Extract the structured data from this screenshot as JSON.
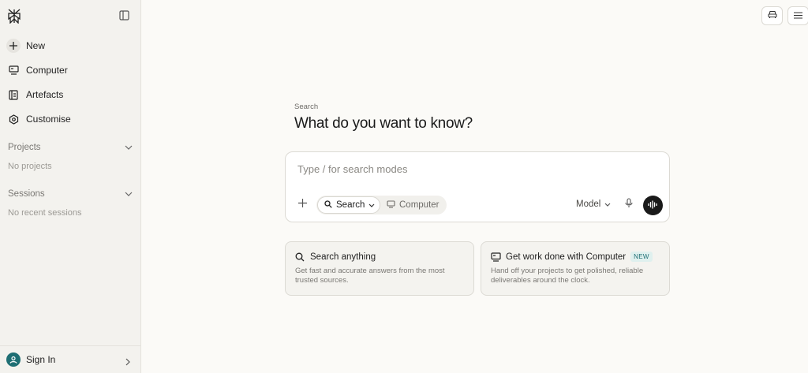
{
  "sidebar": {
    "nav": [
      {
        "label": "New",
        "icon": "plus-icon"
      },
      {
        "label": "Computer",
        "icon": "computer-icon"
      },
      {
        "label": "Artefacts",
        "icon": "artefacts-icon"
      },
      {
        "label": "Customise",
        "icon": "customise-icon"
      }
    ],
    "projects": {
      "title": "Projects",
      "empty": "No projects"
    },
    "sessions": {
      "title": "Sessions",
      "empty": "No recent sessions"
    },
    "signin_label": "Sign In"
  },
  "main": {
    "eyebrow": "Search",
    "headline": "What do you want to know?",
    "composer": {
      "placeholder": "Type / for search modes",
      "mode_search": "Search",
      "mode_computer": "Computer",
      "model_label": "Model"
    },
    "cards": [
      {
        "title": "Search anything",
        "desc": "Get fast and accurate answers from the most trusted sources.",
        "badge": ""
      },
      {
        "title": "Get work done with Computer",
        "desc": "Hand off your projects to get polished, reliable deliverables around the clock.",
        "badge": "NEW"
      }
    ]
  },
  "colors": {
    "accent": "#1e6e73",
    "background": "#fbfaf7",
    "sidebar": "#f3f2ee"
  }
}
